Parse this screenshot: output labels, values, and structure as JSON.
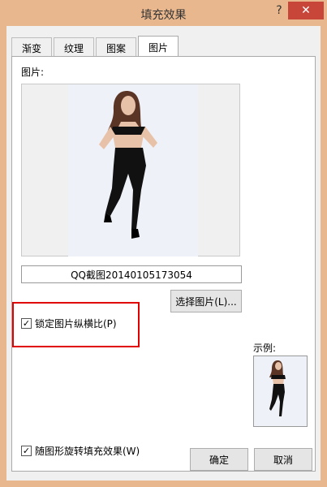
{
  "window": {
    "title": "填充效果",
    "help": "?",
    "close": "✕"
  },
  "tabs": [
    "渐变",
    "纹理",
    "图案",
    "图片"
  ],
  "picture": {
    "label": "图片:",
    "filename": "QQ截图20140105173054",
    "select_button": "选择图片(L)..."
  },
  "options": {
    "lock_aspect": {
      "label": "锁定图片纵横比(P)",
      "checked": true
    },
    "rotate_with_shape": {
      "label": "随图形旋转填充效果(W)",
      "checked": true
    }
  },
  "sample": {
    "label": "示例:"
  },
  "footer": {
    "ok": "确定",
    "cancel": "取消"
  },
  "colors": {
    "title_bar": "#e9b78e",
    "close": "#c8453a",
    "highlight": "#e00000"
  }
}
